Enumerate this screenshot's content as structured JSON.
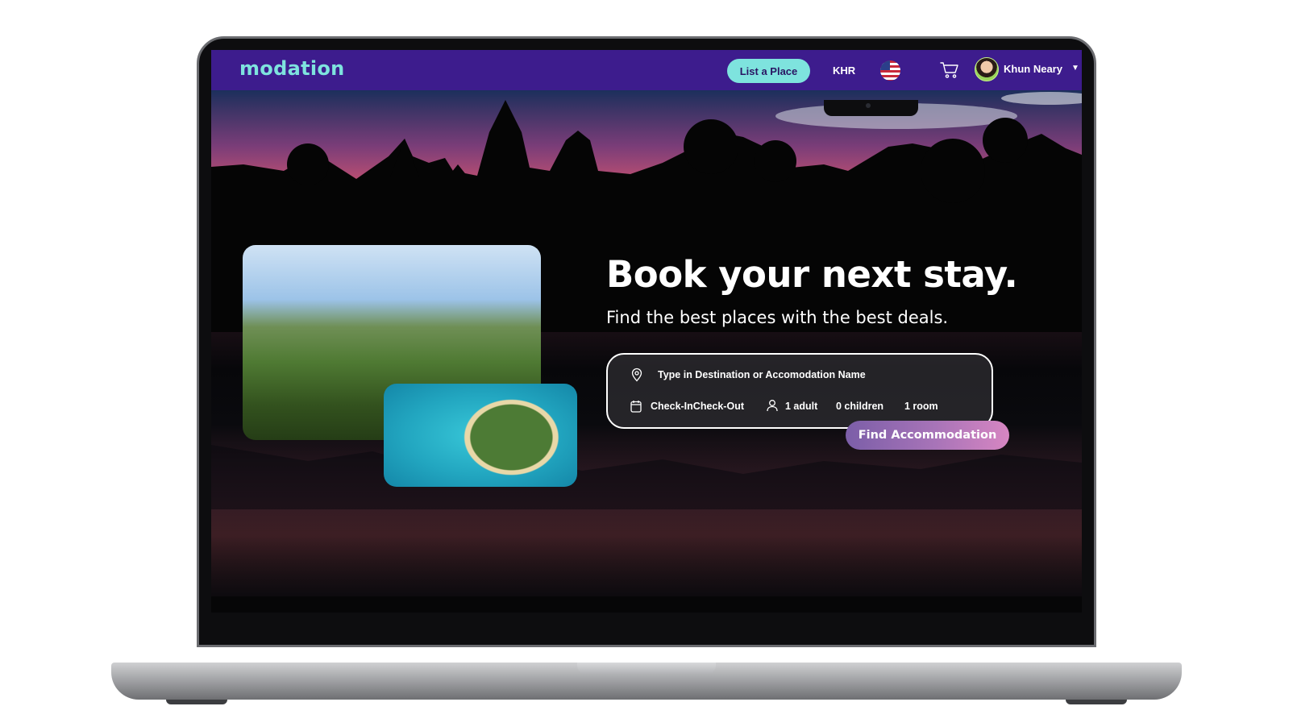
{
  "navbar": {
    "logo": "modation",
    "list_place_label": "List a Place",
    "currency": "KHR",
    "flag_icon": "us-flag-icon",
    "cart_icon": "cart-icon",
    "user_name": "Khun Neary",
    "dropdown_glyph": "▼"
  },
  "hero": {
    "headline": "Book your next stay.",
    "subheadline": "Find the best places with the best deals."
  },
  "search": {
    "destination_placeholder": "Type in Destination or Accomodation Name",
    "dates": "Check-InCheck-Out",
    "adults": "1 adult",
    "children": "0 children",
    "rooms": "1 room",
    "submit_label": "Find Accommodation"
  },
  "colors": {
    "navbar_bg": "#3d1c8d",
    "brand_teal": "#7ee3de",
    "button_gradient_start": "#7b5ea8",
    "button_gradient_end": "#d786c2"
  }
}
